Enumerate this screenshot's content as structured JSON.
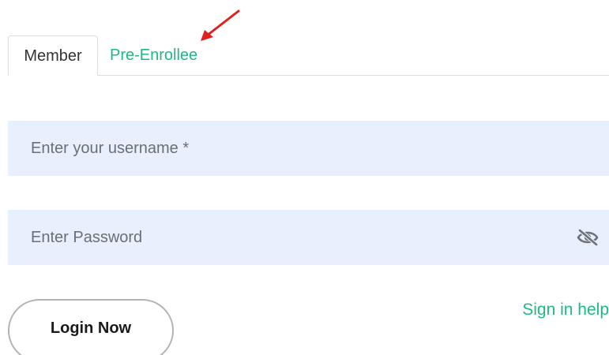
{
  "tabs": [
    {
      "label": "Member",
      "active": true
    },
    {
      "label": "Pre-Enrollee",
      "active": false
    }
  ],
  "username": {
    "placeholder": "Enter your username *",
    "value": ""
  },
  "password": {
    "placeholder": "Enter Password",
    "value": "",
    "toggle_icon": "eye-slash-icon"
  },
  "login_button": {
    "label": "Login Now"
  },
  "help_link": {
    "label": "Sign in help"
  },
  "annotation": {
    "icon": "red-arrow-icon",
    "color": "#e0201c"
  },
  "colors": {
    "accent": "#1fb980",
    "field_background": "#e8f0fe",
    "text": "#333333"
  }
}
